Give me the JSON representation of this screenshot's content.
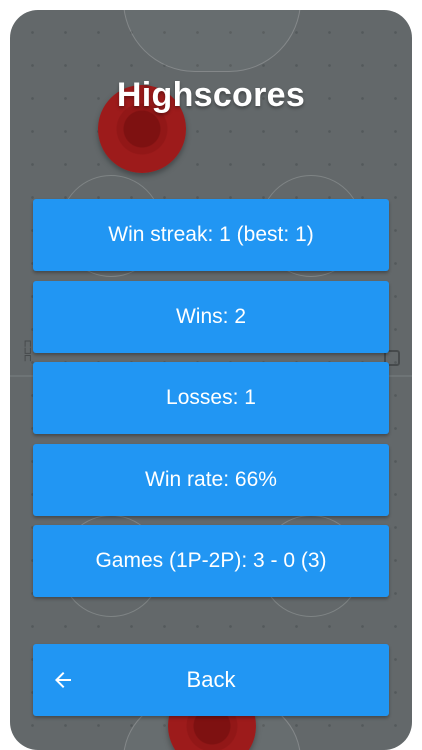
{
  "screen": {
    "title": "Highscores"
  },
  "stats": [
    {
      "label": "Win streak: 1 (best: 1)"
    },
    {
      "label": "Wins: 2"
    },
    {
      "label": "Losses: 1"
    },
    {
      "label": "Win rate: 66%"
    },
    {
      "label": "Games (1P-2P): 3 - 0 (3)"
    }
  ],
  "back_button": {
    "label": "Back",
    "icon": "arrow-left-icon"
  },
  "colors": {
    "button": "#2196f3",
    "table": "#5e6466",
    "mallet": "#9a1414",
    "text": "#ffffff"
  }
}
